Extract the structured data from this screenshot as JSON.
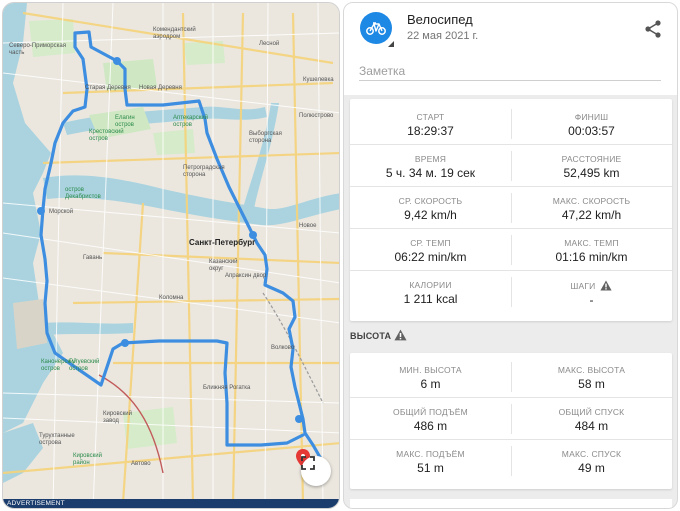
{
  "map": {
    "labels": {
      "l1": "Северо-Приморская часть",
      "l2": "Комендантский аэродром",
      "l3": "Лесной",
      "l4": "Кушелевка",
      "l5": "Старая Деревня",
      "l6": "Новая Деревня",
      "l7": "Елагин остров",
      "l8": "Крестовский остров",
      "l9": "Аптекарский остров",
      "l10": "Выборгская сторона",
      "l11": "Петроградская сторона",
      "l12": "Полюстрово",
      "l13": "остров Декабристов",
      "l14": "Морской",
      "l15": "Гавань",
      "l16": "Санкт-Петербург",
      "l17": "Казанский округ",
      "l18": "Апраксин двор",
      "l19": "Коломна",
      "l20": "Канонерский остров",
      "l21": "Гутуевский остров",
      "l22": "Волково",
      "l23": "Ближняя Рогатка",
      "l24": "Кировский завод",
      "l25": "Турухтанные острова",
      "l26": "Кировский район",
      "l27": "Автово",
      "l28": "Новое"
    },
    "advertisement": "ADVERTISEMENT",
    "expand_icon": "expand-icon",
    "route_color": "#3d8ee0"
  },
  "activity": {
    "title": "Велосипед",
    "date": "22 мая 2021 г.",
    "icon": "bicycle-icon",
    "accent": "#1e88e5",
    "note_placeholder": "Заметка"
  },
  "stats": [
    {
      "left": {
        "label": "СТАРТ",
        "value": "18:29:37"
      },
      "right": {
        "label": "ФИНИШ",
        "value": "00:03:57"
      }
    },
    {
      "left": {
        "label": "ВРЕМЯ",
        "value": "5 ч. 34 м. 19 сек"
      },
      "right": {
        "label": "РАССТОЯНИЕ",
        "value": "52,495 km"
      }
    },
    {
      "left": {
        "label": "СР. СКОРОСТЬ",
        "value": "9,42 km/h"
      },
      "right": {
        "label": "МАКС. СКОРОСТЬ",
        "value": "47,22 km/h"
      }
    },
    {
      "left": {
        "label": "СР. ТЕМП",
        "value": "06:22 min/km"
      },
      "right": {
        "label": "МАКС. ТЕМП",
        "value": "01:16 min/km"
      }
    },
    {
      "left": {
        "label": "КАЛОРИИ",
        "value": "1 211 kcal"
      },
      "right": {
        "label": "ШАГИ",
        "value": "-"
      }
    }
  ],
  "elevation": {
    "section_title": "ВЫСОТА",
    "rows": [
      {
        "left": {
          "label": "МИН. ВЫСОТА",
          "value": "6 m"
        },
        "right": {
          "label": "МАКС. ВЫСОТА",
          "value": "58 m"
        }
      },
      {
        "left": {
          "label": "ОБЩИЙ ПОДЪЁМ",
          "value": "486 m"
        },
        "right": {
          "label": "ОБЩИЙ СПУСК",
          "value": "484 m"
        }
      },
      {
        "left": {
          "label": "МАКС. ПОДЪЁМ",
          "value": "51 m"
        },
        "right": {
          "label": "МАКС. СПУСК",
          "value": "49 m"
        }
      }
    ]
  },
  "colors": {
    "warning": "#616161",
    "map_water": "#aad3df",
    "map_park": "#cfe8c3"
  }
}
